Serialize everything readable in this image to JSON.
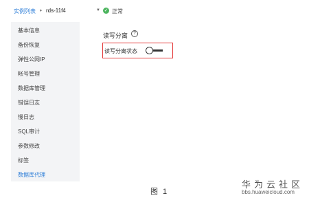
{
  "breadcrumb": {
    "link": "实例列表",
    "separator": "▸",
    "instance": "rds-11f4",
    "caret": "▼",
    "status_icon": "✓",
    "status_text": "正常"
  },
  "sidebar": {
    "items": [
      {
        "label": "基本信息"
      },
      {
        "label": "备份恢复"
      },
      {
        "label": "弹性公网IP"
      },
      {
        "label": "帐号管理"
      },
      {
        "label": "数据库管理"
      },
      {
        "label": "错误日志"
      },
      {
        "label": "慢日志"
      },
      {
        "label": "SQL审计"
      },
      {
        "label": "参数修改"
      },
      {
        "label": "标签"
      },
      {
        "label": "数据库代理"
      }
    ],
    "active_index": 10
  },
  "main": {
    "section_title": "读写分离",
    "help_icon": "?",
    "toggle_label": "读写分离状态",
    "toggle_on": false
  },
  "caption": "图 1",
  "watermark": {
    "cn": "华为云社区",
    "url": "bbs.huaweicloud.com"
  },
  "colors": {
    "link": "#2f7fd8",
    "status": "#4cb45e",
    "highlight": "#e43b3b"
  }
}
